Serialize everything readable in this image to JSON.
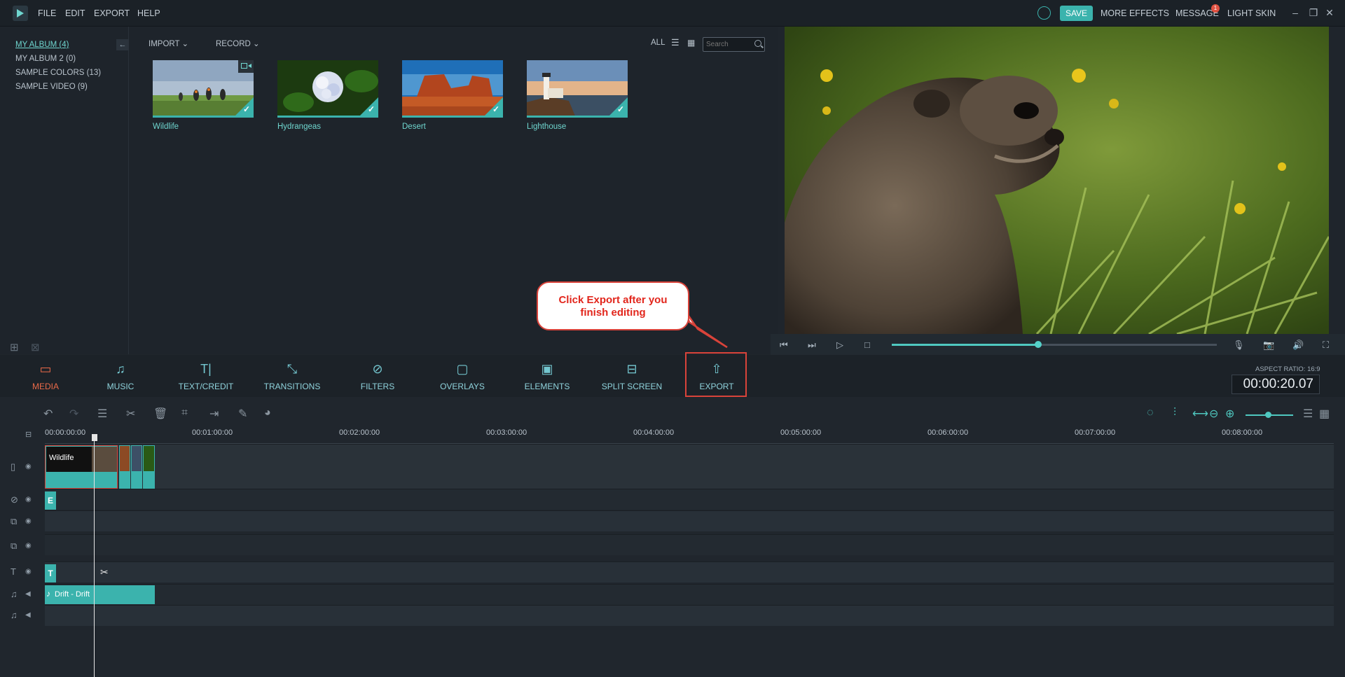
{
  "menu": {
    "file": "FILE",
    "edit": "EDIT",
    "export": "EXPORT",
    "help": "HELP"
  },
  "topbar": {
    "save": "SAVE",
    "more_effects": "MORE EFFECTS",
    "message": "MESSAGE",
    "message_badge": "1",
    "light_skin": "LIGHT SKIN"
  },
  "albums": [
    "MY ALBUM (4)",
    "MY ALBUM 2 (0)",
    "SAMPLE COLORS (13)",
    "SAMPLE VIDEO (9)"
  ],
  "library": {
    "import": "IMPORT",
    "record": "RECORD",
    "all": "ALL",
    "search_placeholder": "Search"
  },
  "media": [
    {
      "label": "Wildlife"
    },
    {
      "label": "Hydrangeas"
    },
    {
      "label": "Desert"
    },
    {
      "label": "Lighthouse"
    }
  ],
  "callout": {
    "line1": "Click Export after you",
    "line2": "finish editing"
  },
  "tabs": [
    {
      "label": "MEDIA",
      "icon": "folder-icon"
    },
    {
      "label": "MUSIC",
      "icon": "music-icon"
    },
    {
      "label": "TEXT/CREDIT",
      "icon": "text-icon"
    },
    {
      "label": "TRANSITIONS",
      "icon": "transitions-icon"
    },
    {
      "label": "FILTERS",
      "icon": "filters-icon"
    },
    {
      "label": "OVERLAYS",
      "icon": "overlays-icon"
    },
    {
      "label": "ELEMENTS",
      "icon": "elements-icon"
    },
    {
      "label": "SPLIT SCREEN",
      "icon": "split-screen-icon"
    },
    {
      "label": "EXPORT",
      "icon": "export-icon"
    }
  ],
  "aspect_ratio": "ASPECT RATIO: 16:9",
  "timecode": "00:00:20.07",
  "ruler": [
    "00:00:00:00",
    "00:01:00:00",
    "00:02:00:00",
    "00:03:00:00",
    "00:04:00:00",
    "00:05:00:00",
    "00:06:00:00",
    "00:07:00:00",
    "00:08:00:00"
  ],
  "clips": {
    "video_title": "Wildlife",
    "effect_badge": "E",
    "text_badge": "T",
    "audio_title": "Drift - Drift"
  },
  "colors": {
    "accent": "#3bb3ad",
    "active_tab": "#ea6a49",
    "callout_border": "#d9433a"
  }
}
